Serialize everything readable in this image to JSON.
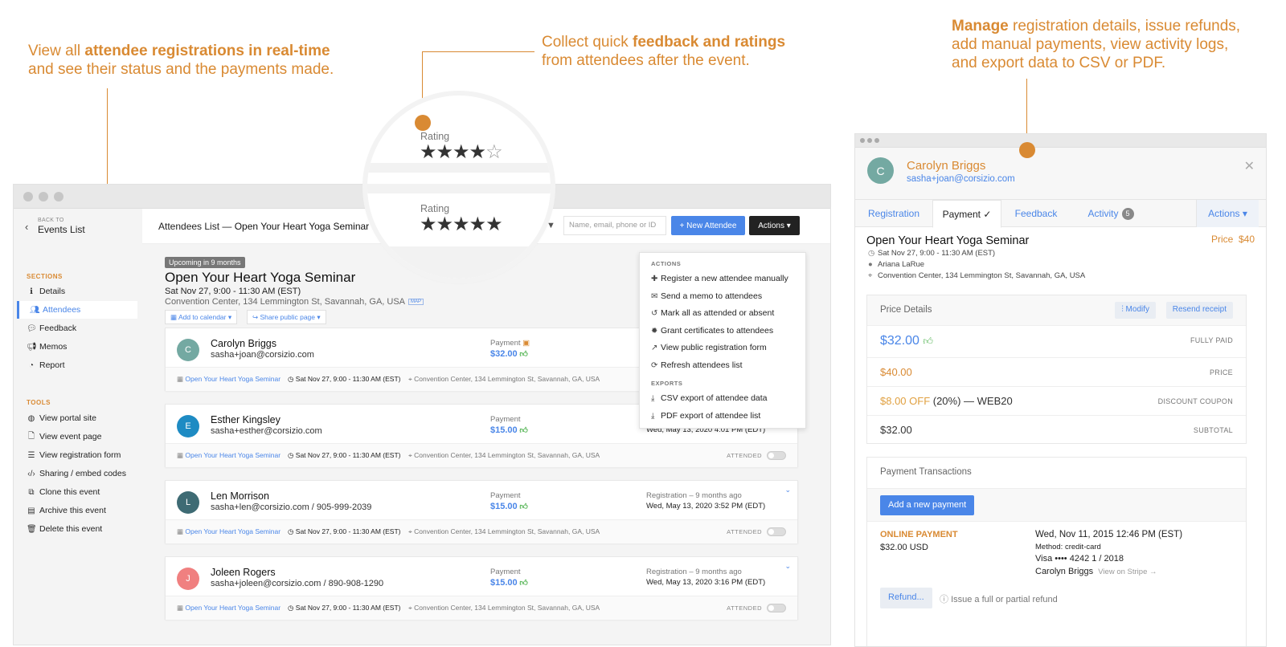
{
  "callouts": {
    "left": {
      "pre": "View all ",
      "bold": "attendee registrations in real-time",
      "line2": "and see their status and the payments made."
    },
    "middle": {
      "pre": "Collect quick ",
      "bold": "feedback and ratings",
      "line2": "from attendees after the event."
    },
    "right": {
      "bold": "Manage",
      "line1": " registration details, issue refunds,",
      "line2": "add manual payments, view activity logs,",
      "line3": "and export data to CSV or PDF."
    }
  },
  "sidebar": {
    "back_small": "BACK TO",
    "back_label": "Events List",
    "sections_heading": "SECTIONS",
    "sections": [
      {
        "label": "Details",
        "icon": "info-icon"
      },
      {
        "label": "Attendees",
        "icon": "users-icon"
      },
      {
        "label": "Feedback",
        "icon": "comments-icon"
      },
      {
        "label": "Memos",
        "icon": "bullhorn-icon"
      },
      {
        "label": "Report",
        "icon": "dashboard-icon"
      }
    ],
    "tools_heading": "TOOLS",
    "tools": [
      {
        "label": "View portal site",
        "icon": "globe-icon"
      },
      {
        "label": "View event page",
        "icon": "file-icon"
      },
      {
        "label": "View registration form",
        "icon": "list-icon"
      },
      {
        "label": "Sharing / embed codes",
        "icon": "code-icon"
      },
      {
        "label": "Clone this event",
        "icon": "clone-icon"
      },
      {
        "label": "Archive this event",
        "icon": "archive-icon"
      },
      {
        "label": "Delete this event",
        "icon": "trash-icon"
      }
    ]
  },
  "topbar": {
    "crumb_prefix": "Attendees List — ",
    "crumb_event": "Open Your Heart Yoga Seminar",
    "search_placeholder": "Name, email, phone or ID",
    "new_attendee": "+ New Attendee",
    "actions": "Actions ▾"
  },
  "event": {
    "badge": "Upcoming in 9 months",
    "title": "Open Your Heart Yoga Seminar",
    "date": "Sat Nov 27, 9:00 - 11:30 AM (EST)",
    "location": "Convention Center, 134 Lemmington St, Savannah, GA, USA",
    "map": "MAP",
    "add_to_calendar": "Add to calendar ▾",
    "share_public_page": "Share public page ▾"
  },
  "attendees": [
    {
      "initial": "C",
      "color": "#74a9a2",
      "name": "Carolyn Briggs",
      "contact": "sasha+joan@corsizio.com",
      "payment_label": "Payment",
      "payment": "$32.00",
      "reg_label": "",
      "reg_date": ""
    },
    {
      "initial": "E",
      "color": "#1e8bc3",
      "name": "Esther Kingsley",
      "contact": "sasha+esther@corsizio.com",
      "payment_label": "Payment",
      "payment": "$15.00",
      "reg_label": "Registration – 9 months ago",
      "reg_date": "Wed, May 13, 2020 4:01 PM (EDT)"
    },
    {
      "initial": "L",
      "color": "#3e6b74",
      "name": "Len Morrison",
      "contact": "sasha+len@corsizio.com / 905-999-2039",
      "payment_label": "Payment",
      "payment": "$15.00",
      "reg_label": "Registration – 9 months ago",
      "reg_date": "Wed, May 13, 2020 3:52 PM (EDT)"
    },
    {
      "initial": "J",
      "color": "#f08080",
      "name": "Joleen Rogers",
      "contact": "sasha+joleen@corsizio.com / 890-908-1290",
      "payment_label": "Payment",
      "payment": "$15.00",
      "reg_label": "Registration – 9 months ago",
      "reg_date": "Wed, May 13, 2020 3:16 PM (EDT)"
    }
  ],
  "card_footer": {
    "event": "Open Your Heart Yoga Seminar",
    "date": "Sat Nov 27, 9:00 - 11:30 AM (EST)",
    "location": "Convention Center, 134 Lemmington St, Savannah, GA, USA",
    "attended": "ATTENDED"
  },
  "dropdown": {
    "actions_heading": "ACTIONS",
    "actions": [
      {
        "label": "Register a new attendee manually",
        "icon": "plus-icon"
      },
      {
        "label": "Send a memo to attendees",
        "icon": "envelope-icon"
      },
      {
        "label": "Mark all as attended or absent",
        "icon": "history-icon"
      },
      {
        "label": "Grant certificates to attendees",
        "icon": "certificate-icon"
      },
      {
        "label": "View public registration form",
        "icon": "external-link-icon"
      },
      {
        "label": "Refresh attendees list",
        "icon": "refresh-icon"
      }
    ],
    "exports_heading": "EXPORTS",
    "exports": [
      {
        "label": "CSV export of attendee data",
        "icon": "download-icon"
      },
      {
        "label": "PDF export of attendee list",
        "icon": "download-icon"
      }
    ]
  },
  "ratings": [
    {
      "label": "Rating",
      "stars": 4,
      "max": 5
    },
    {
      "label": "Rating",
      "stars": 5,
      "max": 5
    }
  ],
  "detail": {
    "initial": "C",
    "name": "Carolyn Briggs",
    "email": "sasha+joan@corsizio.com",
    "tabs": [
      "Registration",
      "Payment ✓",
      "Feedback",
      "Activity"
    ],
    "activity_count": "5",
    "actions": "Actions ▾",
    "event_title": "Open Your Heart Yoga Seminar",
    "event_date": "Sat Nov 27, 9:00 - 11:30 AM (EST)",
    "event_host": "Ariana LaRue",
    "event_location": "Convention Center, 134 Lemmington St, Savannah, GA, USA",
    "price_label": "Price",
    "price": "$40",
    "price_details": {
      "title": "Price Details",
      "modify": "Modify",
      "resend": "Resend receipt",
      "rows": [
        {
          "value": "$32.00",
          "key": "FULLY PAID",
          "color": "#4a86e8"
        },
        {
          "value": "$40.00",
          "key": "PRICE",
          "color": "#d98a33"
        },
        {
          "value": "$8.00 OFF",
          "value_suffix": " (20%) — WEB20",
          "key": "DISCOUNT COUPON",
          "color": "#e0a040"
        },
        {
          "value": "$32.00",
          "key": "SUBTOTAL",
          "color": "#333"
        }
      ]
    },
    "transactions": {
      "title": "Payment Transactions",
      "add": "Add a new payment",
      "type": "ONLINE PAYMENT",
      "amount": "$32.00 USD",
      "date": "Wed, Nov 11, 2015 12:46 PM (EST)",
      "method": "Method: credit-card",
      "card": "Visa •••• 4242   1 / 2018",
      "payer": "Carolyn Briggs",
      "stripe": "View on Stripe →",
      "refund": "Refund...",
      "refund_note": "Issue a full or partial refund"
    }
  }
}
